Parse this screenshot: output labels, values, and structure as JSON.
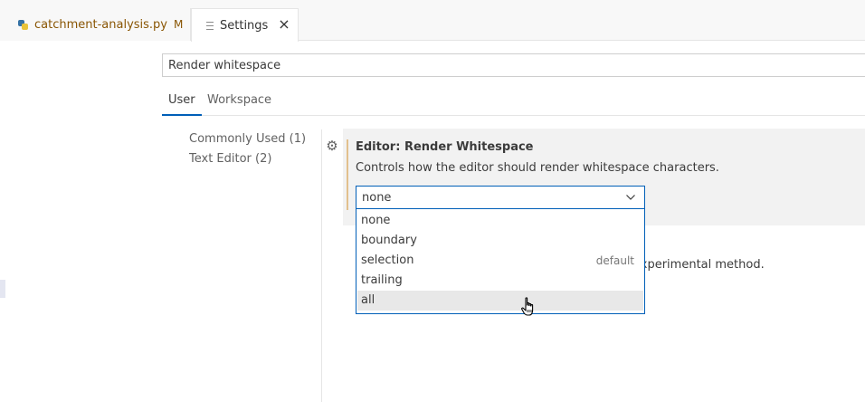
{
  "tabs": {
    "file_tab": {
      "label": "catchment-analysis.py",
      "modified_badge": "M"
    },
    "settings_tab": {
      "label": "Settings",
      "close_glyph": "×"
    }
  },
  "search": {
    "value": "Render whitespace"
  },
  "scopes": {
    "user": "User",
    "workspace": "Workspace"
  },
  "toc": [
    {
      "label": "Commonly Used",
      "count": "(1)"
    },
    {
      "label": "Text Editor",
      "count": "(2)"
    }
  ],
  "setting": {
    "category": "Editor: ",
    "name": "Render Whitespace",
    "description": "Controls how the editor should render whitespace characters.",
    "selected_value": "none",
    "options": [
      {
        "label": "none",
        "note": ""
      },
      {
        "label": "boundary",
        "note": ""
      },
      {
        "label": "selection",
        "note": "default"
      },
      {
        "label": "trailing",
        "note": ""
      },
      {
        "label": "all",
        "note": ""
      }
    ],
    "hovered_option": "all"
  },
  "background_text": "experimental method.",
  "colors": {
    "accent": "#005fb8",
    "modified": "#895503",
    "setting_bar": "#e2c08d"
  },
  "icons": [
    "python-file-icon",
    "settings-file-icon",
    "close-icon",
    "gear-icon",
    "chevron-down-icon",
    "hand-cursor-icon"
  ]
}
